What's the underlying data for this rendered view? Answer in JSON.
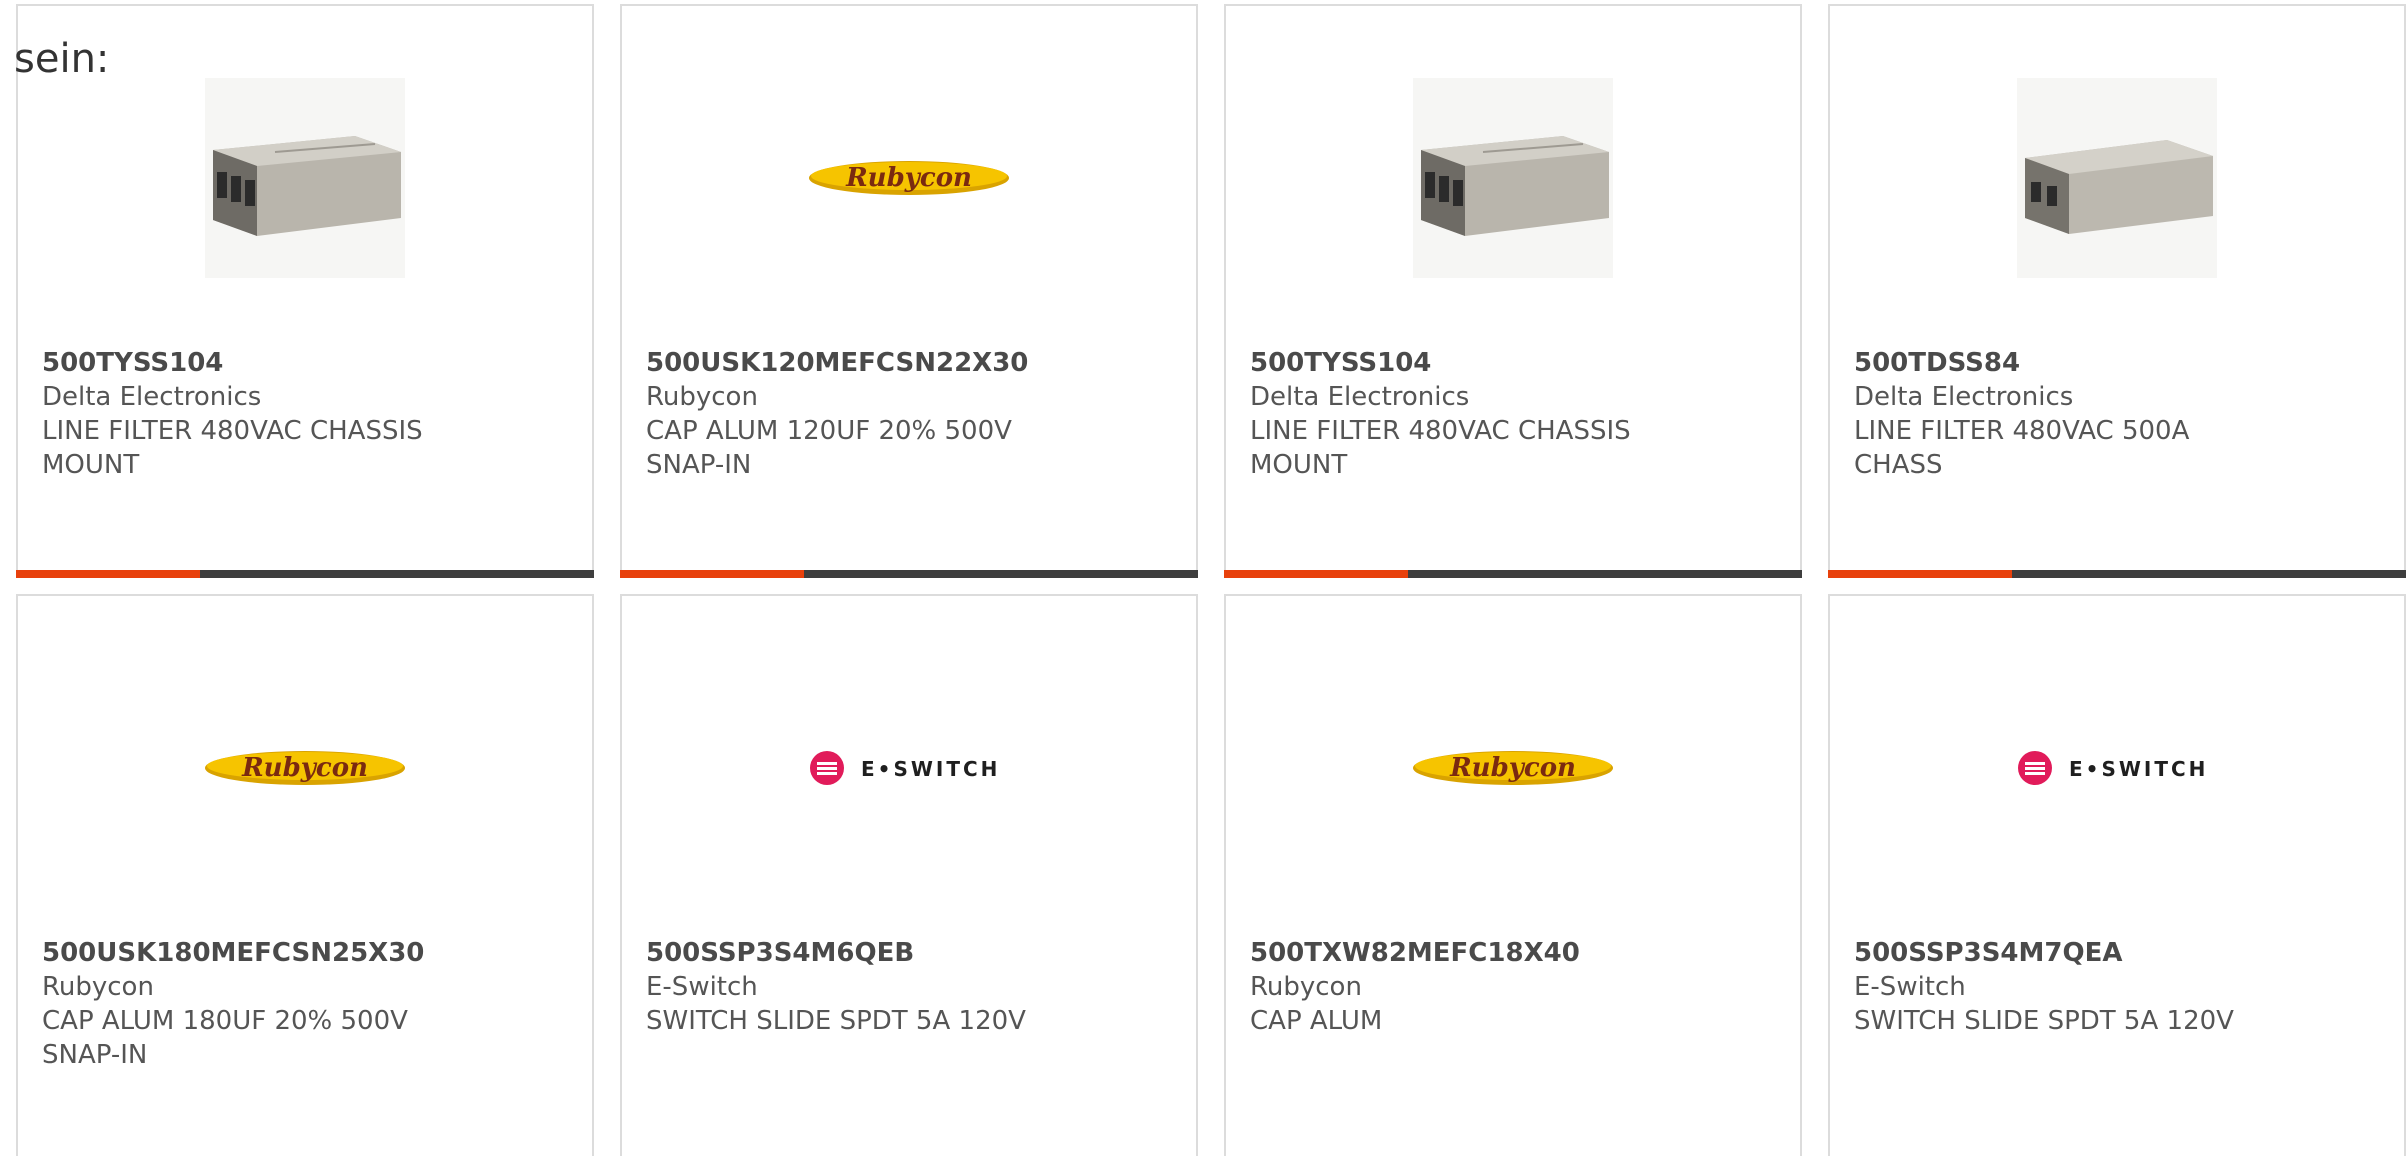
{
  "header": {
    "lead_text": "sein:"
  },
  "colors": {
    "accent": "#e8410c",
    "bar": "#3e3e3e",
    "border": "#dcdcdc"
  },
  "products": [
    {
      "part_number": "500TYSS104",
      "manufacturer": "Delta Electronics",
      "description": "LINE FILTER 480VAC CHASSIS MOUNT",
      "image": "line-filter-photo"
    },
    {
      "part_number": "500USK120MEFCSN22X30",
      "manufacturer": "Rubycon",
      "description": "CAP ALUM 120UF 20% 500V SNAP-IN",
      "image": "rubycon-logo"
    },
    {
      "part_number": "500TYSS104",
      "manufacturer": "Delta Electronics",
      "description": "LINE FILTER 480VAC CHASSIS MOUNT",
      "image": "line-filter-photo"
    },
    {
      "part_number": "500TDSS84",
      "manufacturer": "Delta Electronics",
      "description": "LINE FILTER 480VAC 500A CHASS",
      "image": "line-filter-photo"
    },
    {
      "part_number": "500USK180MEFCSN25X30",
      "manufacturer": "Rubycon",
      "description": "CAP ALUM 180UF 20% 500V SNAP-IN",
      "image": "rubycon-logo"
    },
    {
      "part_number": "500SSP3S4M6QEB",
      "manufacturer": "E-Switch",
      "description": "SWITCH SLIDE SPDT 5A 120V",
      "image": "eswitch-logo"
    },
    {
      "part_number": "500TXW82MEFC18X40",
      "manufacturer": "Rubycon",
      "description": "CAP ALUM",
      "image": "rubycon-logo"
    },
    {
      "part_number": "500SSP3S4M7QEA",
      "manufacturer": "E-Switch",
      "description": "SWITCH SLIDE SPDT 5A 120V",
      "image": "eswitch-logo"
    }
  ],
  "logos": {
    "rubycon_text": "Rubycon",
    "eswitch_text": "E•SWITCH"
  }
}
